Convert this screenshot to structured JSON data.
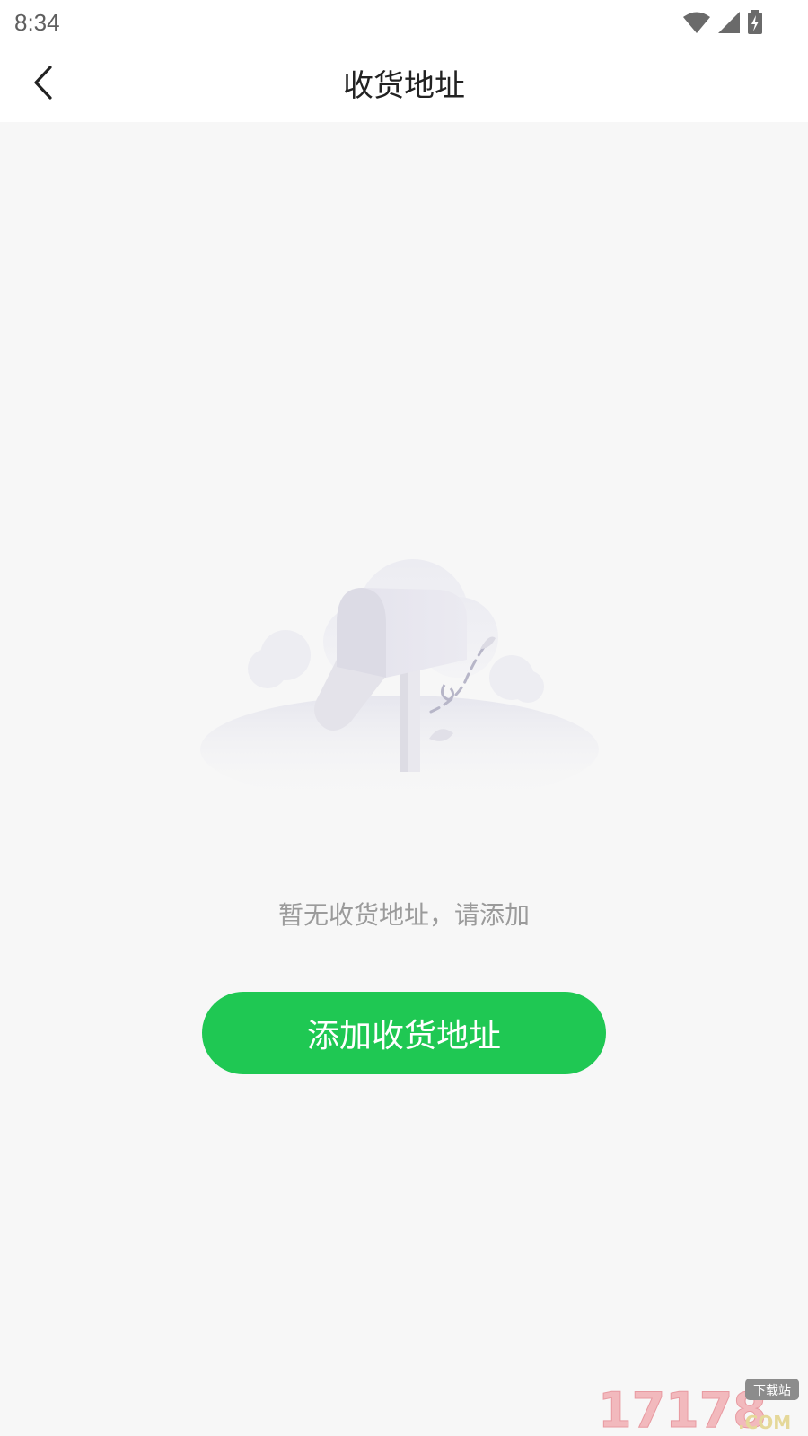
{
  "status_bar": {
    "time": "8:34",
    "icons": [
      "wifi-icon",
      "signal-icon",
      "battery-charging-icon"
    ]
  },
  "header": {
    "title": "收货地址",
    "back_icon": "chevron-left-icon"
  },
  "empty_state": {
    "illustration": "mailbox-illustration",
    "message": "暂无收货地址，请添加"
  },
  "actions": {
    "add_address_label": "添加收货地址"
  },
  "watermark": {
    "text": "17178",
    "suffix": ".COM",
    "badge": "下载站"
  },
  "colors": {
    "accent": "#1fc853",
    "background": "#f7f7f7",
    "muted_text": "#9b9b9b"
  }
}
